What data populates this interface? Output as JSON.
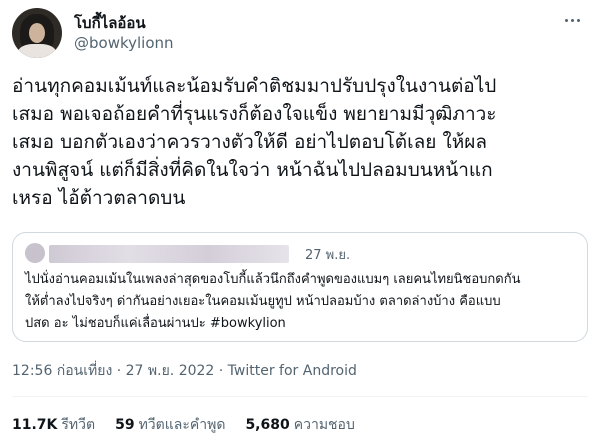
{
  "author": {
    "display_name": "โบกี้ไลอ้อน",
    "handle": "@bowkylionn"
  },
  "tweet": {
    "lines": [
      "อ่านทุกคอมเม้นท์และน้อมรับคำติชมมาปรับปรุงในงานต่อไป",
      "เสมอ พอเจอถ้อยคำที่รุนแรงก็ต้องใจแข็ง พยายามมีวุฒิภาวะ",
      "เสมอ บอกตัวเองว่าควรวางตัวให้ดี อย่าไปตอบโต้เลย ให้ผล",
      "งานพิสูจน์ แต่ก็มีสิ่งที่คิดในใจว่า หน้าฉันไปปลอมบนหน้าแก",
      "เหรอ ไอ้ต้าวตลาดบน"
    ]
  },
  "quoted_tweet": {
    "date": "27 พ.ย.",
    "lines": [
      "ไปนั่งอ่านคอมเม้นในเพลงล่าสุดของโบกี้แล้วนึกถึงคำพูดของแบมๆ เลยคนไทยนิชอบกดกัน",
      "ให้ต่ำลงไปจริงๆ ด่ากันอย่างเยอะในคอมเม้นยูทูป หน้าปลอมบ้าง ตลาดล่างบ้าง คือแบบ",
      "ปสด อะ ไม่ชอบก็แค่เลื่อนผ่านปะ #bowkylion"
    ]
  },
  "meta": {
    "timestamp": "12:56 ก่อนเที่ยง · 27 พ.ย. 2022 · Twitter for Android"
  },
  "stats": {
    "retweets_count": "11.7K",
    "retweets_label": "รีทวีต",
    "quotes_count": "59",
    "quotes_label": "ทวีตและคำพูด",
    "likes_count": "5,680",
    "likes_label": "ความชอบ"
  },
  "icons": {
    "more": "more-horizontal-icon"
  }
}
